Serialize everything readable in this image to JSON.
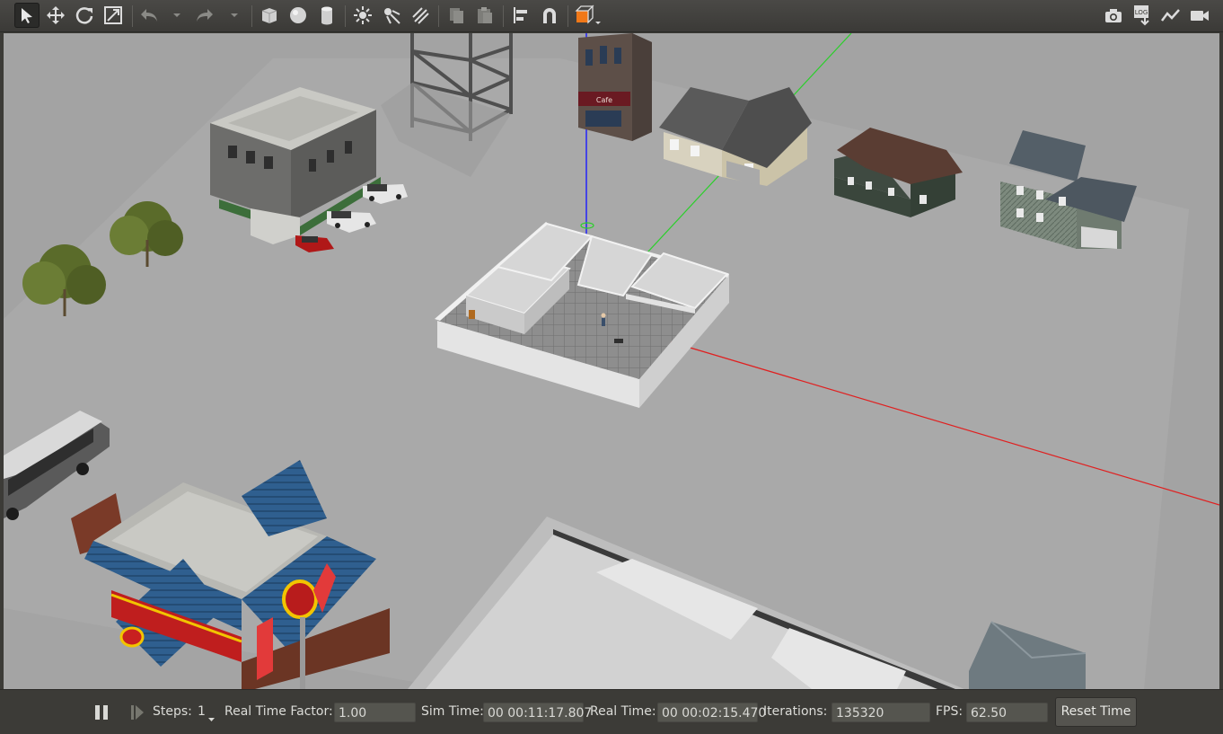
{
  "toolbar": {
    "tools": [
      {
        "name": "select-mode",
        "icon": "arrow-cursor-icon",
        "active": true
      },
      {
        "name": "translate-mode",
        "icon": "move-arrows-icon"
      },
      {
        "name": "rotate-mode",
        "icon": "rotate-icon"
      },
      {
        "name": "scale-mode",
        "icon": "scale-icon"
      },
      {
        "name": "undo",
        "icon": "undo-icon"
      },
      {
        "name": "undo-history",
        "icon": "dropdown-icon"
      },
      {
        "name": "redo",
        "icon": "redo-icon"
      },
      {
        "name": "redo-history",
        "icon": "dropdown-icon"
      },
      {
        "name": "insert-box",
        "icon": "box-icon"
      },
      {
        "name": "insert-sphere",
        "icon": "sphere-icon"
      },
      {
        "name": "insert-cylinder",
        "icon": "cylinder-icon"
      },
      {
        "name": "point-light",
        "icon": "sun-icon"
      },
      {
        "name": "spot-light",
        "icon": "spot-light-icon"
      },
      {
        "name": "directional-light",
        "icon": "directional-light-icon"
      },
      {
        "name": "copy",
        "icon": "copy-icon"
      },
      {
        "name": "paste",
        "icon": "paste-icon"
      },
      {
        "name": "align",
        "icon": "align-icon"
      },
      {
        "name": "snap",
        "icon": "magnet-icon"
      },
      {
        "name": "view-angle",
        "icon": "orange-cube-icon"
      }
    ],
    "right_tools": [
      {
        "name": "screenshot",
        "icon": "camera-icon"
      },
      {
        "name": "log",
        "icon": "log-icon",
        "text": "LOG"
      },
      {
        "name": "plot",
        "icon": "plot-icon"
      },
      {
        "name": "video-record",
        "icon": "video-camera-icon"
      }
    ]
  },
  "status": {
    "steps_label": "Steps:",
    "steps_value": "1",
    "rtf_label": "Real Time Factor:",
    "rtf_value": "1.00",
    "sim_time_label": "Sim Time:",
    "sim_time_value": "00 00:11:17.807",
    "real_time_label": "Real Time:",
    "real_time_value": "00 00:02:15.470",
    "iterations_label": "Iterations:",
    "iterations_value": "135320",
    "fps_label": "FPS:",
    "fps_value": "62.50",
    "reset_label": "Reset Time"
  },
  "scene": {
    "sign_text": "Cafe",
    "colors": {
      "ground": "#a6a6a6",
      "x_axis": "#e02020",
      "y_axis": "#2ad02a",
      "z_axis": "#1a1aff",
      "accent": "#f07818"
    }
  }
}
